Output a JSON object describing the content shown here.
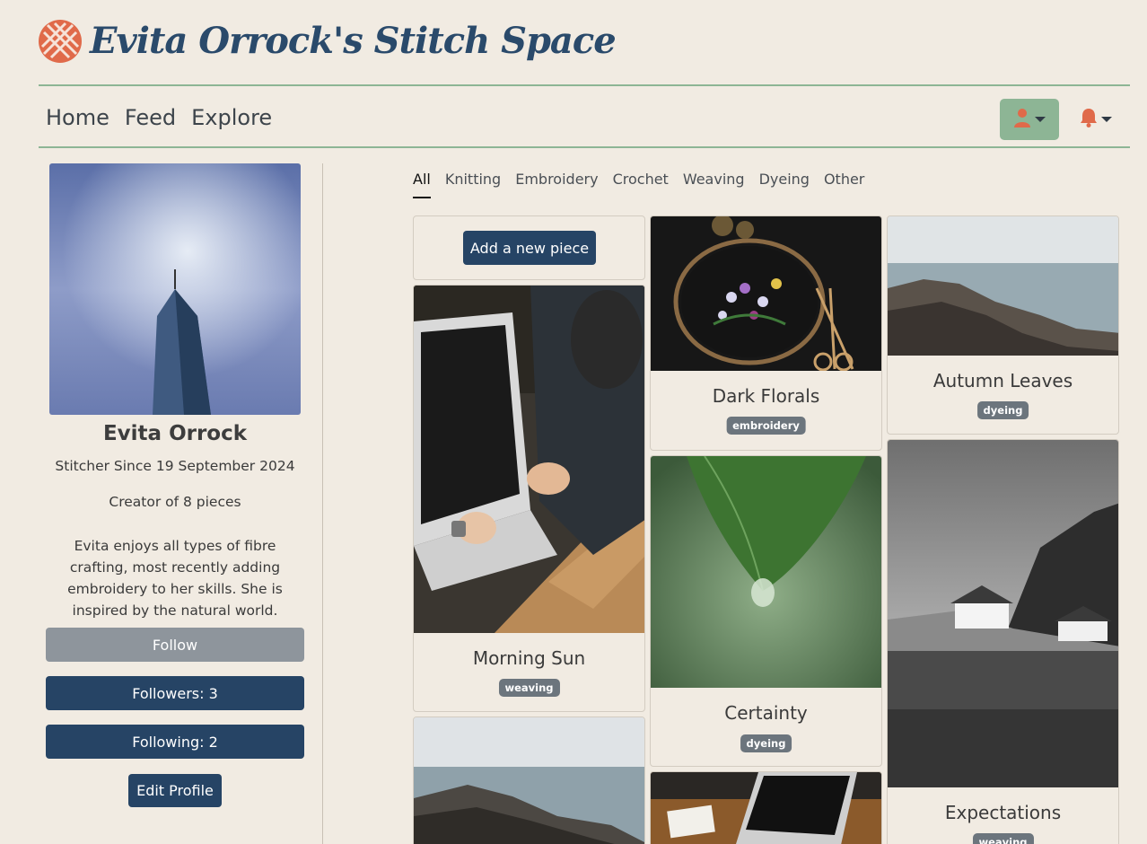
{
  "site": {
    "title": "Evita Orrock's Stitch Space",
    "logo_icon": "lattice-logo-icon",
    "accent_color": "#e06a4a",
    "brand_color": "#2a4a6b"
  },
  "nav": {
    "items": [
      {
        "label": "Home"
      },
      {
        "label": "Feed"
      },
      {
        "label": "Explore"
      }
    ],
    "user_menu_icon": "user-icon",
    "notifications_icon": "bell-icon"
  },
  "profile": {
    "name": "Evita Orrock",
    "since": "Stitcher Since 19 September 2024",
    "creator": "Creator of 8 pieces",
    "bio": "Evita enjoys all types of fibre crafting, most recently adding embroidery to her skills. She is inspired by the natural world.",
    "follow_label": "Follow",
    "followers_label": "Followers: 3",
    "following_label": "Following: 2",
    "edit_label": "Edit Profile"
  },
  "tabs": [
    {
      "label": "All",
      "active": true
    },
    {
      "label": "Knitting"
    },
    {
      "label": "Embroidery"
    },
    {
      "label": "Crochet"
    },
    {
      "label": "Weaving"
    },
    {
      "label": "Dyeing"
    },
    {
      "label": "Other"
    }
  ],
  "add_piece_label": "Add a new piece",
  "pieces": [
    {
      "title": "Morning Sun",
      "tag": "weaving"
    },
    {
      "title": "Dark Florals",
      "tag": "embroidery"
    },
    {
      "title": "Certainty",
      "tag": "dyeing"
    },
    {
      "title": "Autumn Leaves",
      "tag": "dyeing"
    },
    {
      "title": "Expectations",
      "tag": "weaving"
    }
  ]
}
